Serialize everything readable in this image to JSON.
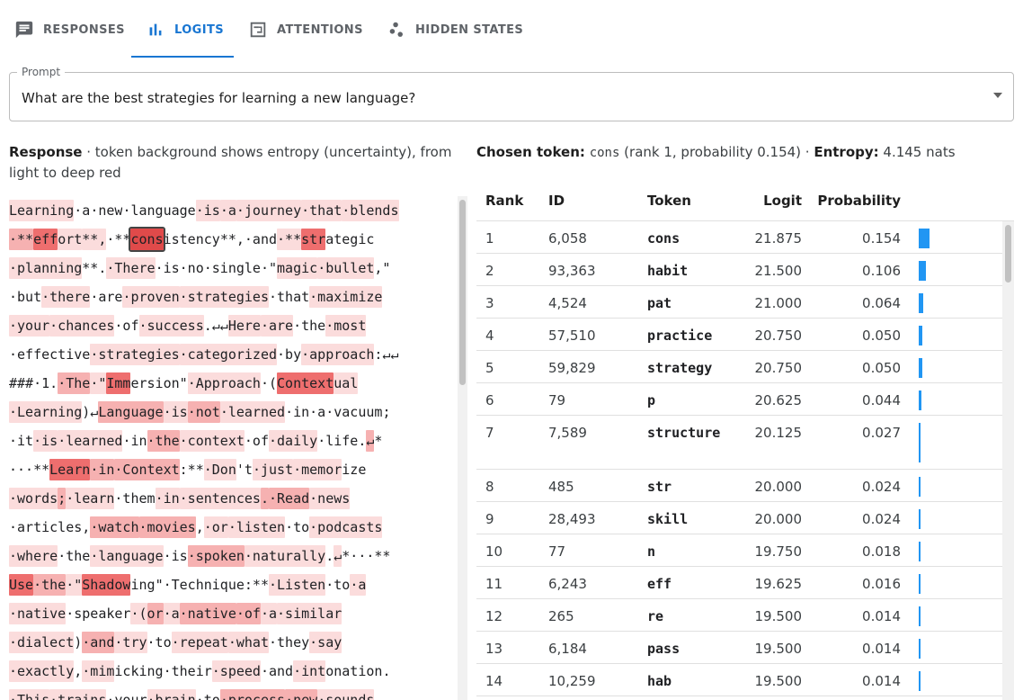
{
  "tabs": [
    {
      "label": "RESPONSES",
      "icon": "chat-icon",
      "active": false
    },
    {
      "label": "LOGITS",
      "icon": "bar-chart-icon",
      "active": true
    },
    {
      "label": "ATTENTIONS",
      "icon": "attention-icon",
      "active": false
    },
    {
      "label": "HIDDEN STATES",
      "icon": "scatter-icon",
      "active": false
    }
  ],
  "prompt": {
    "label": "Prompt",
    "value": "What are the best strategies for learning a new language?"
  },
  "response_header": {
    "title": "Response",
    "description": " · token background shows entropy (uncertainty), from light to deep red"
  },
  "chosen": {
    "label": "Chosen token:",
    "token": "cons",
    "details": " (rank 1, probability 0.154) · ",
    "entropy_label": "Entropy:",
    "entropy_value": " 4.145 nats"
  },
  "table": {
    "headers": {
      "rank": "Rank",
      "id": "ID",
      "token": "Token",
      "logit": "Logit",
      "probability": "Probability"
    },
    "rows": [
      {
        "rank": "1",
        "id": "6,058",
        "token": "cons",
        "logit": "21.875",
        "prob": "0.154"
      },
      {
        "rank": "2",
        "id": "93,363",
        "token": "habit",
        "logit": "21.500",
        "prob": "0.106"
      },
      {
        "rank": "3",
        "id": "4,524",
        "token": "pat",
        "logit": "21.000",
        "prob": "0.064"
      },
      {
        "rank": "4",
        "id": "57,510",
        "token": "practice",
        "logit": "20.750",
        "prob": "0.050"
      },
      {
        "rank": "5",
        "id": "59,829",
        "token": "strategy",
        "logit": "20.750",
        "prob": "0.050"
      },
      {
        "rank": "6",
        "id": "79",
        "token": "p",
        "logit": "20.625",
        "prob": "0.044"
      },
      {
        "rank": "7",
        "id": "7,589",
        "token": "structure",
        "logit": "20.125",
        "prob": "0.027"
      },
      {
        "rank": "8",
        "id": "485",
        "token": "str",
        "logit": "20.000",
        "prob": "0.024"
      },
      {
        "rank": "9",
        "id": "28,493",
        "token": "skill",
        "logit": "20.000",
        "prob": "0.024"
      },
      {
        "rank": "10",
        "id": "77",
        "token": "n",
        "logit": "19.750",
        "prob": "0.018"
      },
      {
        "rank": "11",
        "id": "6,243",
        "token": "eff",
        "logit": "19.625",
        "prob": "0.016"
      },
      {
        "rank": "12",
        "id": "265",
        "token": "re",
        "logit": "19.500",
        "prob": "0.014"
      },
      {
        "rank": "13",
        "id": "6,184",
        "token": "pass",
        "logit": "19.500",
        "prob": "0.014"
      },
      {
        "rank": "14",
        "id": "10,259",
        "token": "hab",
        "logit": "19.500",
        "prob": "0.014"
      }
    ]
  },
  "response_tokens": [
    [
      [
        "Learning",
        1
      ],
      [
        "·a",
        0
      ],
      [
        "·new",
        0
      ],
      [
        "·language",
        0
      ],
      [
        "·is",
        1
      ],
      [
        "·a",
        1
      ],
      [
        "·journey",
        1
      ],
      [
        "·that",
        1
      ],
      [
        "·blends",
        1
      ]
    ],
    [
      [
        "·**",
        2
      ],
      [
        "eff",
        3
      ],
      [
        "ort",
        1
      ],
      [
        "**,",
        1
      ],
      [
        "·**",
        0
      ],
      [
        "cons",
        4,
        true
      ],
      [
        "istency",
        0
      ],
      [
        "**,",
        0
      ],
      [
        "·and",
        0
      ],
      [
        "·**",
        1
      ],
      [
        "str",
        3
      ],
      [
        "ategic",
        0
      ]
    ],
    [
      [
        "·planning",
        1
      ],
      [
        "**.",
        0
      ],
      [
        "·There",
        1
      ],
      [
        "·is",
        0
      ],
      [
        "·no",
        0
      ],
      [
        "·single",
        0
      ],
      [
        "·\"",
        0
      ],
      [
        "magic",
        1
      ],
      [
        "·bullet",
        1
      ],
      [
        ",\"",
        0
      ]
    ],
    [
      [
        "·but",
        0
      ],
      [
        "·there",
        1
      ],
      [
        "·are",
        0
      ],
      [
        "·proven",
        1
      ],
      [
        "·strategies",
        1
      ],
      [
        "·that",
        0
      ],
      [
        "·maximize",
        1
      ]
    ],
    [
      [
        "·your",
        1
      ],
      [
        "·chances",
        1
      ],
      [
        "·of",
        0
      ],
      [
        "·success",
        1
      ],
      [
        ".↵↵",
        0
      ],
      [
        "Here",
        1
      ],
      [
        "·are",
        1
      ],
      [
        "·the",
        0
      ],
      [
        "·most",
        1
      ]
    ],
    [
      [
        "·effective",
        0
      ],
      [
        "·strategies",
        1
      ],
      [
        "·categorized",
        1
      ],
      [
        "·by",
        0
      ],
      [
        "·approach",
        1
      ],
      [
        ":↵↵",
        0
      ]
    ],
    [
      [
        "###",
        0
      ],
      [
        "·1",
        0
      ],
      [
        ".",
        0
      ],
      [
        "·The",
        2
      ],
      [
        "·\"",
        1
      ],
      [
        "Imm",
        3
      ],
      [
        "ersion",
        0
      ],
      [
        "\"",
        0
      ],
      [
        "·Approach",
        1
      ],
      [
        "·(",
        0
      ],
      [
        "Context",
        3
      ],
      [
        "ual",
        1
      ]
    ],
    [
      [
        "·Learning",
        1
      ],
      [
        ")↵",
        0
      ],
      [
        "Language",
        2
      ],
      [
        "·is",
        1
      ],
      [
        "·not",
        2
      ],
      [
        "·learned",
        1
      ],
      [
        "·in",
        0
      ],
      [
        "·a",
        0
      ],
      [
        "·vacuum",
        0
      ],
      [
        ";",
        0
      ]
    ],
    [
      [
        "·it",
        0
      ],
      [
        "·is",
        1
      ],
      [
        "·learned",
        1
      ],
      [
        "·in",
        0
      ],
      [
        "·the",
        2
      ],
      [
        "·context",
        1
      ],
      [
        "·of",
        0
      ],
      [
        "·daily",
        1
      ],
      [
        "·life",
        0
      ],
      [
        ".",
        0
      ],
      [
        "↵",
        2
      ],
      [
        "*",
        0
      ]
    ],
    [
      [
        "···**",
        0
      ],
      [
        "Learn",
        3
      ],
      [
        "·in",
        2
      ],
      [
        "·Context",
        2
      ],
      [
        ":**",
        0
      ],
      [
        "·Don",
        1
      ],
      [
        "'t",
        0
      ],
      [
        "·just",
        1
      ],
      [
        "·memor",
        1
      ],
      [
        "ize",
        0
      ]
    ],
    [
      [
        "·words",
        1
      ],
      [
        ";",
        2
      ],
      [
        "·learn",
        1
      ],
      [
        "·them",
        0
      ],
      [
        "·in",
        1
      ],
      [
        "·sentences",
        1
      ],
      [
        ".",
        2
      ],
      [
        "·Read",
        2
      ],
      [
        "·news",
        1
      ]
    ],
    [
      [
        "·articles",
        0
      ],
      [
        ",",
        0
      ],
      [
        "·watch",
        2
      ],
      [
        "·movies",
        2
      ],
      [
        ",",
        0
      ],
      [
        "·or",
        1
      ],
      [
        "·listen",
        1
      ],
      [
        "·to",
        0
      ],
      [
        "·podcasts",
        1
      ]
    ],
    [
      [
        "·where",
        1
      ],
      [
        "·the",
        0
      ],
      [
        "·language",
        1
      ],
      [
        "·is",
        0
      ],
      [
        "·spoken",
        2
      ],
      [
        "·naturally",
        1
      ],
      [
        ".",
        0
      ],
      [
        "↵",
        1
      ],
      [
        "*···**",
        0
      ]
    ],
    [
      [
        "Use",
        3
      ],
      [
        "·the",
        2
      ],
      [
        "·\"",
        1
      ],
      [
        "Shadow",
        3
      ],
      [
        "ing",
        0
      ],
      [
        "\"",
        0
      ],
      [
        "·Technique",
        0
      ],
      [
        ":**",
        0
      ],
      [
        "·Listen",
        1
      ],
      [
        "·to",
        0
      ],
      [
        "·a",
        1
      ]
    ],
    [
      [
        "·native",
        1
      ],
      [
        "·speaker",
        0
      ],
      [
        "·(",
        1
      ],
      [
        "or",
        2
      ],
      [
        "·a",
        1
      ],
      [
        "·native",
        2
      ],
      [
        "·of",
        2
      ],
      [
        "·a",
        1
      ],
      [
        "·similar",
        1
      ]
    ],
    [
      [
        "·dialect",
        1
      ],
      [
        ")",
        0
      ],
      [
        "·and",
        2
      ],
      [
        "·try",
        1
      ],
      [
        "·to",
        0
      ],
      [
        "·repeat",
        1
      ],
      [
        "·what",
        1
      ],
      [
        "·they",
        0
      ],
      [
        "·say",
        1
      ]
    ],
    [
      [
        "·exactly",
        1
      ],
      [
        ",",
        0
      ],
      [
        "·mim",
        1
      ],
      [
        "icking",
        0
      ],
      [
        "·their",
        0
      ],
      [
        "·speed",
        1
      ],
      [
        "·and",
        0
      ],
      [
        "·int",
        1
      ],
      [
        "onation",
        0
      ],
      [
        ".",
        0
      ]
    ],
    [
      [
        "·This",
        1
      ],
      [
        "·trains",
        1
      ],
      [
        "·your",
        0
      ],
      [
        "·brain",
        1
      ],
      [
        "·to",
        0
      ],
      [
        "·process",
        2
      ],
      [
        "·new",
        2
      ],
      [
        "·sounds",
        1
      ]
    ]
  ],
  "entropy_colors": [
    "#ffffff",
    "#fbdcdc",
    "#f6b1b1",
    "#ee6e6e",
    "#e04a4a"
  ]
}
